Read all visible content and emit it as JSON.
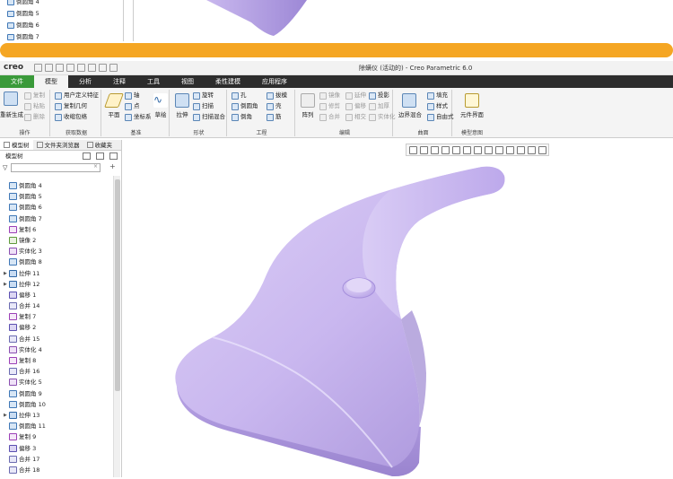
{
  "top_preview": {
    "tree_items": [
      "倒圆角 4",
      "倒圆角 5",
      "倒圆角 6",
      "倒圆角 7"
    ]
  },
  "titlebar": {
    "logo": "creo",
    "title": "除螨仪 (活动的) - Creo Parametric 6.0"
  },
  "tabs": [
    {
      "label": "文件",
      "state": "file"
    },
    {
      "label": "模型",
      "state": "active"
    },
    {
      "label": "分析",
      "state": ""
    },
    {
      "label": "注释",
      "state": ""
    },
    {
      "label": "工具",
      "state": ""
    },
    {
      "label": "视图",
      "state": ""
    },
    {
      "label": "柔性建模",
      "state": ""
    },
    {
      "label": "应用程序",
      "state": ""
    }
  ],
  "ribbon": {
    "operations": {
      "label": "操作",
      "regen": "重新生成",
      "copy": "复制",
      "paste": "粘贴",
      "delete": "删除"
    },
    "get_data": {
      "label": "获取数据",
      "udf": "用户定义特征",
      "copy_geom": "复制几何",
      "shrinkwrap": "收缩包络"
    },
    "datum": {
      "label": "基准",
      "plane": "平面",
      "axis": "轴",
      "point": "点",
      "csys": "坐标系",
      "sketch": "草绘"
    },
    "shapes": {
      "label": "形状",
      "extrude": "拉伸",
      "revolve": "旋转",
      "sweep": "扫描",
      "swept_blend": "扫描混合"
    },
    "engineering": {
      "label": "工程",
      "hole": "孔",
      "round": "倒圆角",
      "chamfer": "倒角",
      "draft": "拔模",
      "shell": "壳",
      "rib": "筋"
    },
    "editing": {
      "label": "编辑",
      "pattern": "阵列",
      "mirror": "镜像",
      "extend": "延伸",
      "project": "投影",
      "trim": "修剪",
      "offset": "偏移",
      "thicken": "加厚",
      "merge": "合并",
      "intersect": "相交",
      "solidify": "实体化"
    },
    "surfaces": {
      "label": "曲面",
      "boundary": "边界混合",
      "fill": "填充",
      "style": "样式",
      "freestyle": "自由式"
    },
    "intent": {
      "label": "模型意图",
      "component_interface": "元件界面"
    }
  },
  "panel": {
    "tabs": [
      "模型树",
      "文件夹浏览器",
      "收藏夹"
    ],
    "header": "模型树",
    "items": [
      {
        "label": "倒圆角 4",
        "icon": "round",
        "exp": ""
      },
      {
        "label": "倒圆角 5",
        "icon": "round",
        "exp": ""
      },
      {
        "label": "倒圆角 6",
        "icon": "round",
        "exp": ""
      },
      {
        "label": "倒圆角 7",
        "icon": "round",
        "exp": ""
      },
      {
        "label": "复制 6",
        "icon": "copy",
        "exp": ""
      },
      {
        "label": "镜像 2",
        "icon": "mirror",
        "exp": ""
      },
      {
        "label": "实体化 3",
        "icon": "solid",
        "exp": ""
      },
      {
        "label": "倒圆角 8",
        "icon": "round",
        "exp": ""
      },
      {
        "label": "拉伸 11",
        "icon": "extrude",
        "exp": "▶"
      },
      {
        "label": "拉伸 12",
        "icon": "extrude",
        "exp": "▶"
      },
      {
        "label": "偏移 1",
        "icon": "offset",
        "exp": ""
      },
      {
        "label": "合并 14",
        "icon": "merge",
        "exp": ""
      },
      {
        "label": "复制 7",
        "icon": "copy",
        "exp": ""
      },
      {
        "label": "偏移 2",
        "icon": "offset",
        "exp": ""
      },
      {
        "label": "合并 15",
        "icon": "merge",
        "exp": ""
      },
      {
        "label": "实体化 4",
        "icon": "solid",
        "exp": ""
      },
      {
        "label": "复制 8",
        "icon": "copy",
        "exp": ""
      },
      {
        "label": "合并 16",
        "icon": "merge",
        "exp": ""
      },
      {
        "label": "实体化 5",
        "icon": "solid",
        "exp": ""
      },
      {
        "label": "倒圆角 9",
        "icon": "round",
        "exp": ""
      },
      {
        "label": "倒圆角 10",
        "icon": "round",
        "exp": ""
      },
      {
        "label": "拉伸 13",
        "icon": "extrude",
        "exp": "▶"
      },
      {
        "label": "倒圆角 11",
        "icon": "round",
        "exp": ""
      },
      {
        "label": "复制 9",
        "icon": "copy",
        "exp": ""
      },
      {
        "label": "偏移 3",
        "icon": "offset",
        "exp": ""
      },
      {
        "label": "合并 17",
        "icon": "merge",
        "exp": ""
      },
      {
        "label": "合并 18",
        "icon": "merge",
        "exp": ""
      }
    ]
  },
  "colors": {
    "accent_bar": "#f5a623",
    "file_tab": "#3a9a3a",
    "model": "#cdbdf0"
  }
}
